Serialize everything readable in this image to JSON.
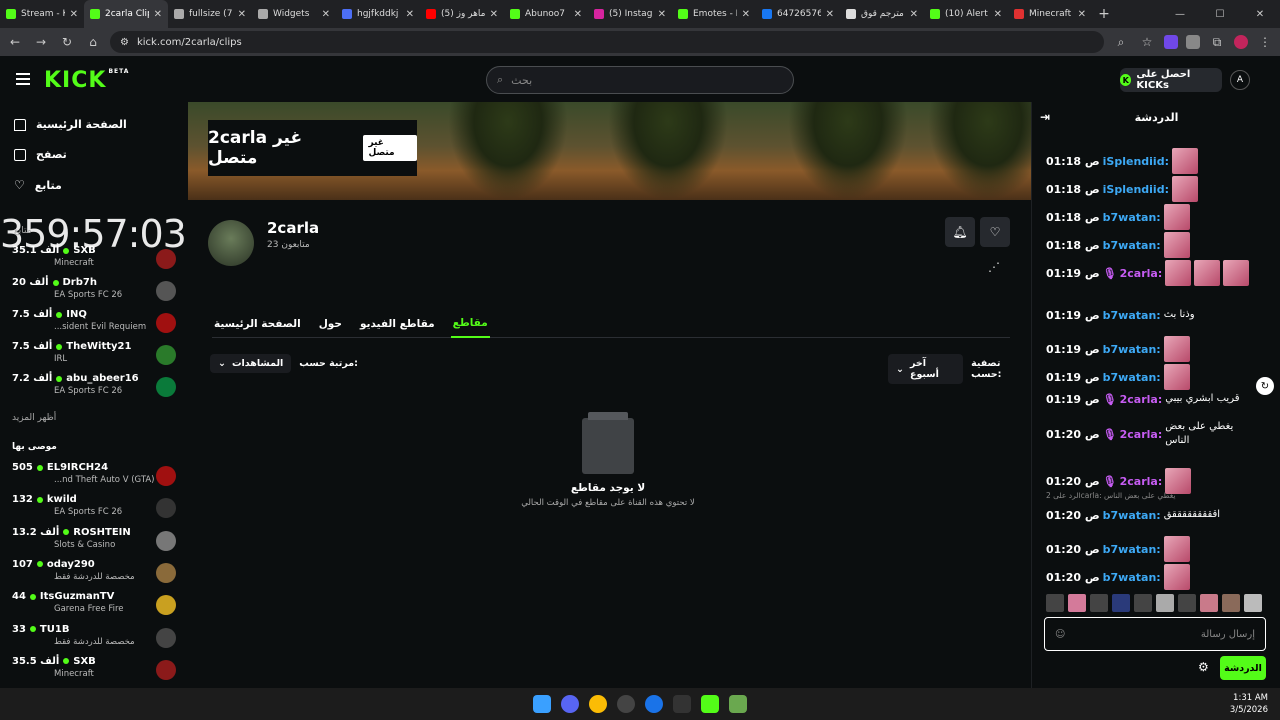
{
  "browser": {
    "tabs": [
      {
        "label": "Stream - K",
        "color": "#53fc18"
      },
      {
        "label": "2carla Clip",
        "color": "#53fc18",
        "active": true
      },
      {
        "label": "fullsize (70",
        "color": "#aaaaaa"
      },
      {
        "label": "Widgets",
        "color": "#aaaaaa"
      },
      {
        "label": "hgjfkddkj",
        "color": "#4c6ef5"
      },
      {
        "label": "(5) ماهر وز",
        "color": "#ff0000"
      },
      {
        "label": "Abunoo7",
        "color": "#53fc18"
      },
      {
        "label": "(5) Instagr",
        "color": "#d6249f"
      },
      {
        "label": "Emotes - K",
        "color": "#53fc18"
      },
      {
        "label": "64726576",
        "color": "#1877f2"
      },
      {
        "label": "مترجم قوق",
        "color": "#dddddd"
      },
      {
        "label": "(10) Alert",
        "color": "#53fc18"
      },
      {
        "label": "Minecraft",
        "color": "#e03131"
      }
    ],
    "url": "kick.com/2carla/clips",
    "new_tab": "+",
    "tab_close": "✕"
  },
  "header": {
    "logo": "KICK",
    "logo_badge": "BETA",
    "search_placeholder": "بحث",
    "kicks_label": "احصل على KICKs",
    "kicks_icon": "K"
  },
  "sidebar": {
    "nav": [
      {
        "label": "الصفحة الرئيسية",
        "icon": "home-icon"
      },
      {
        "label": "تصفح",
        "icon": "browse-icon"
      },
      {
        "label": "متابع",
        "icon": "heart-icon"
      }
    ],
    "timer": "359:57:03",
    "following_title": "متابع",
    "following": [
      {
        "viewers": "35.1 ألف",
        "name": "SXB",
        "game": "Minecraft"
      },
      {
        "viewers": "20 ألف",
        "name": "Drb7h",
        "game": "EA Sports FC 26"
      },
      {
        "viewers": "7.5 ألف",
        "name": "INQ",
        "game": "...sident Evil Requiem"
      },
      {
        "viewers": "7.5 ألف",
        "name": "TheWitty21",
        "game": "IRL"
      },
      {
        "viewers": "7.2 ألف",
        "name": "abu_abeer16",
        "game": "EA Sports FC 26"
      }
    ],
    "show_more": "أظهر المزيد",
    "recommended_title": "موصى بها",
    "recommended": [
      {
        "viewers": "505",
        "name": "EL9IRCH24",
        "game": "...nd Theft Auto V (GTA)"
      },
      {
        "viewers": "132",
        "name": "kwild",
        "game": "EA Sports FC 26"
      },
      {
        "viewers": "13.2 ألف",
        "name": "ROSHTEIN",
        "game": "Slots & Casino"
      },
      {
        "viewers": "107",
        "name": "oday290",
        "game": "مخصصة للدردشة فقط"
      },
      {
        "viewers": "44",
        "name": "ItsGuzmanTV",
        "game": "Garena Free Fire"
      },
      {
        "viewers": "33",
        "name": "TU1B",
        "game": "مخصصة للدردشة فقط"
      },
      {
        "viewers": "35.5 ألف",
        "name": "SXB",
        "game": "Minecraft"
      }
    ]
  },
  "channel": {
    "offline_title": "2carla غير متصل",
    "offline_tag": "غير متصل",
    "name": "2carla",
    "followers": "23 متابعون",
    "tabs": [
      "مقاطع",
      "مقاطع الفيديو",
      "حول",
      "الصفحة الرئيسية"
    ],
    "active_tab": "مقاطع",
    "filter_label": "تصفية حسب:",
    "filter_value": "آخر أسبوع",
    "sort_label": "مرتبة حسب:",
    "sort_value": "المشاهدات",
    "empty_title": "لا يوجد مقاطع",
    "empty_sub": "لا تحتوي هذه القناة على مقاطع في الوقت الحالي"
  },
  "chat": {
    "title": "الدردشة",
    "messages": [
      {
        "time": "01:18 ص",
        "user": "iSplendiid:",
        "color": "#3da9f5",
        "text": "",
        "emotes": 1
      },
      {
        "time": "01:18 ص",
        "user": "iSplendiid:",
        "color": "#3da9f5",
        "text": "",
        "emotes": 1
      },
      {
        "time": "01:18 ص",
        "user": "b7watan:",
        "color": "#3da9f5",
        "text": "",
        "emotes": 1
      },
      {
        "time": "01:18 ص",
        "user": "b7watan:",
        "color": "#3da9f5",
        "text": "",
        "emotes": 1
      },
      {
        "time": "01:19 ص",
        "user": "2carla:",
        "color": "#c65cf2",
        "text": "",
        "emotes": 3
      },
      {
        "time": "01:19 ص",
        "user": "b7watan:",
        "color": "#3da9f5",
        "text": "وذنا بث",
        "emotes": 0
      },
      {
        "time": "01:19 ص",
        "user": "b7watan:",
        "color": "#3da9f5",
        "text": "",
        "emotes": 1
      },
      {
        "time": "01:19 ص",
        "user": "b7watan:",
        "color": "#3da9f5",
        "text": "",
        "emotes": 1
      },
      {
        "time": "01:19 ص",
        "user": "2carla:",
        "color": "#c65cf2",
        "text": "قريب ابشري بيبي",
        "emotes": 0
      },
      {
        "time": "01:20 ص",
        "user": "2carla:",
        "color": "#c65cf2",
        "text": "يغطي على بعض الناس",
        "emotes": 0
      },
      {
        "time": "01:20 ص",
        "user": "2carla:",
        "color": "#c65cf2",
        "text": "",
        "emotes": 1
      },
      {
        "time": "01:20 ص",
        "user": "b7watan:",
        "color": "#3da9f5",
        "text": "اقققققققققق",
        "emotes": 0
      },
      {
        "time": "01:20 ص",
        "user": "b7watan:",
        "color": "#3da9f5",
        "text": "",
        "emotes": 1
      },
      {
        "time": "01:20 ص",
        "user": "b7watan:",
        "color": "#3da9f5",
        "text": "",
        "emotes": 1
      }
    ],
    "reply_note": "الرد على 2carla: يغطي على بعض الناس",
    "input_placeholder": "إرسال رسالة",
    "send_label": "الدردشة"
  },
  "taskbar": {
    "time": "1:31 AM",
    "date": "3/5/2026"
  }
}
